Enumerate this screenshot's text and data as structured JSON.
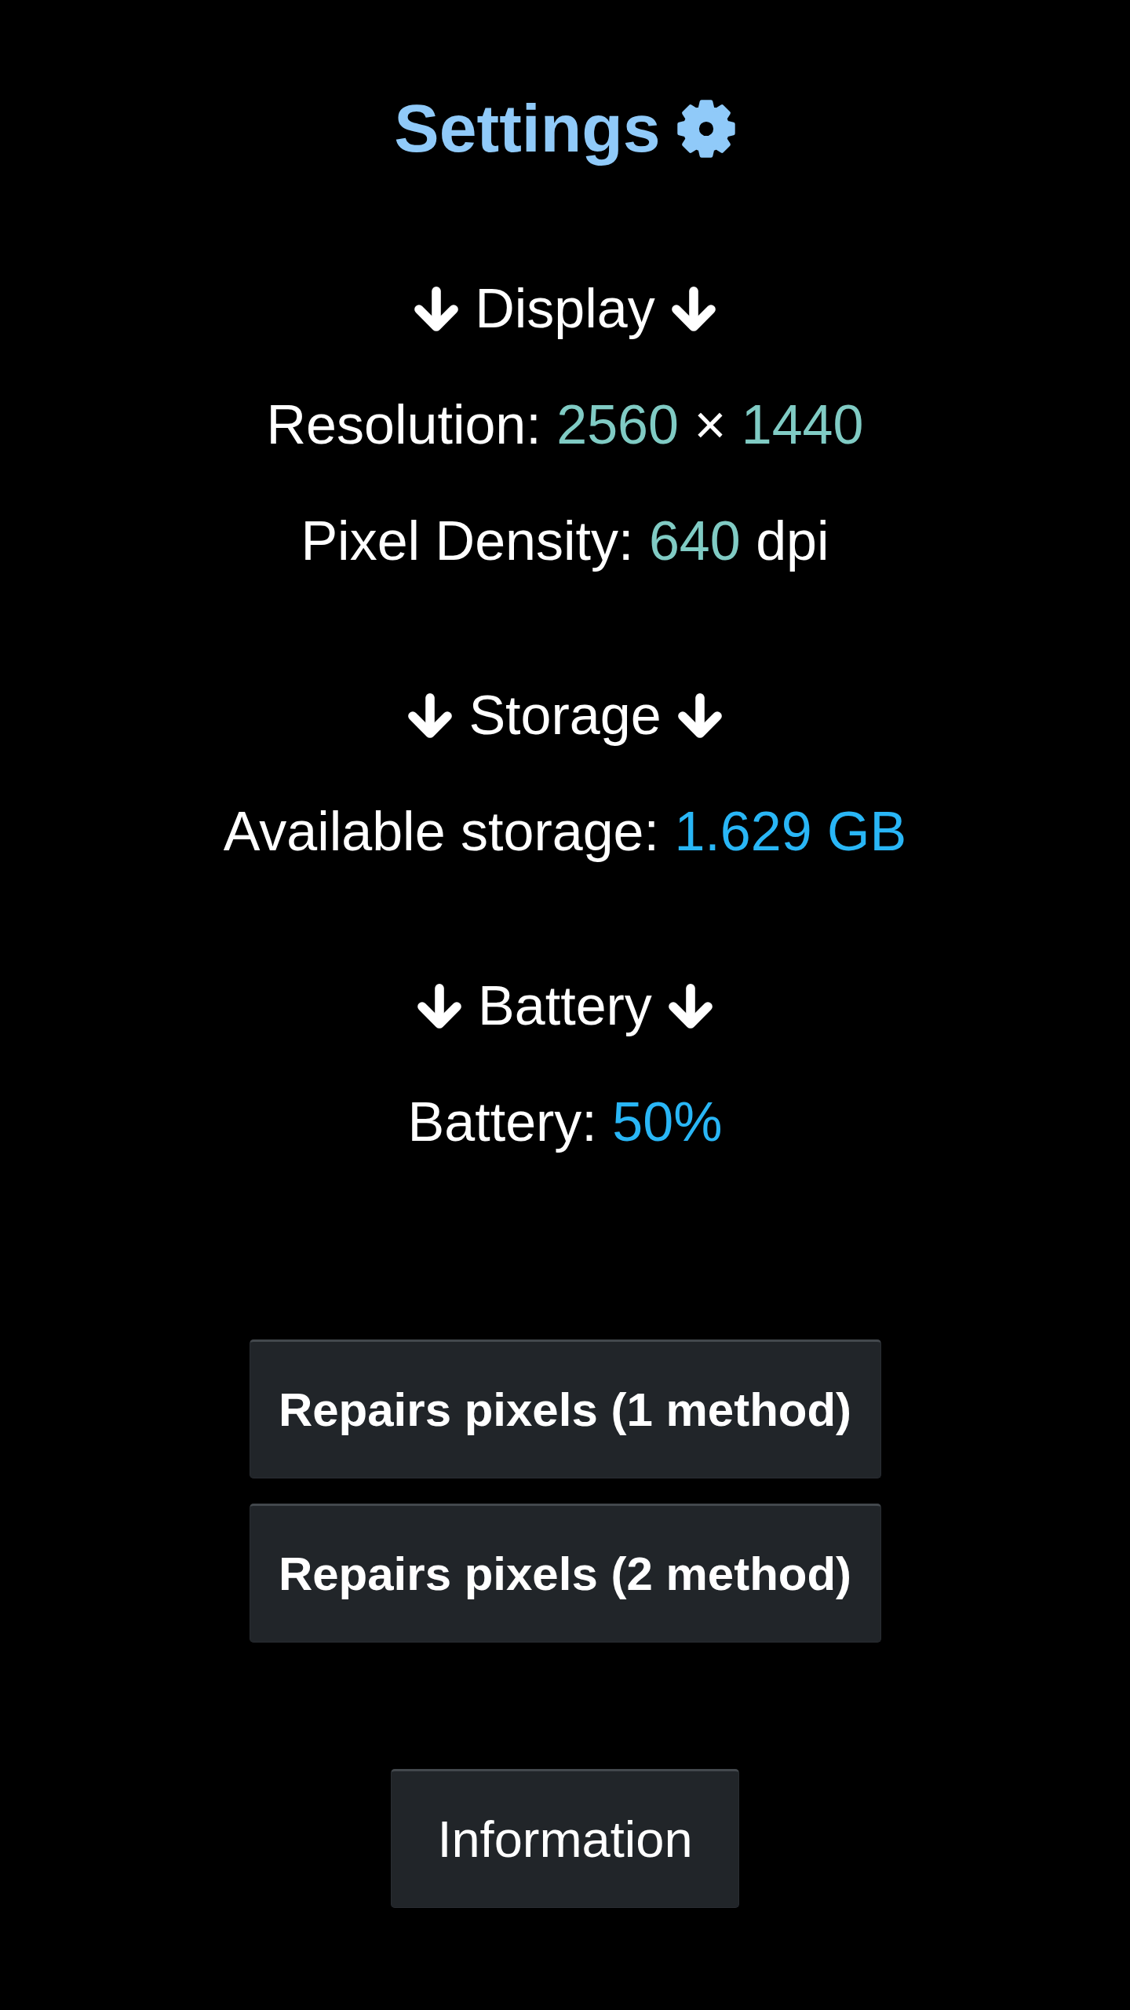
{
  "title": {
    "text": "Settings"
  },
  "sections": [
    {
      "heading": "Display",
      "rows": [
        {
          "parts": [
            {
              "kind": "label",
              "text": "Resolution:"
            },
            {
              "kind": "value",
              "text": "2560",
              "color": "#80cbc4"
            },
            {
              "kind": "label",
              "text": "×"
            },
            {
              "kind": "value",
              "text": "1440",
              "color": "#80cbc4"
            }
          ]
        },
        {
          "parts": [
            {
              "kind": "label",
              "text": "Pixel Density:"
            },
            {
              "kind": "value",
              "text": "640",
              "color": "#80cbc4"
            },
            {
              "kind": "label",
              "text": "dpi"
            }
          ]
        }
      ]
    },
    {
      "heading": "Storage",
      "rows": [
        {
          "parts": [
            {
              "kind": "label",
              "text": "Available storage:"
            },
            {
              "kind": "value",
              "text": "1.629 GB",
              "color": "#29b6f6"
            }
          ]
        }
      ]
    },
    {
      "heading": "Battery",
      "rows": [
        {
          "parts": [
            {
              "kind": "label",
              "text": "Battery:"
            },
            {
              "kind": "value",
              "text": "50%",
              "color": "#29b6f6"
            }
          ]
        }
      ]
    }
  ],
  "repair_buttons": [
    {
      "label": "Repairs pixels (1 method)"
    },
    {
      "label": "Repairs pixels (2 method)"
    }
  ],
  "info_button": {
    "label": "Information"
  }
}
